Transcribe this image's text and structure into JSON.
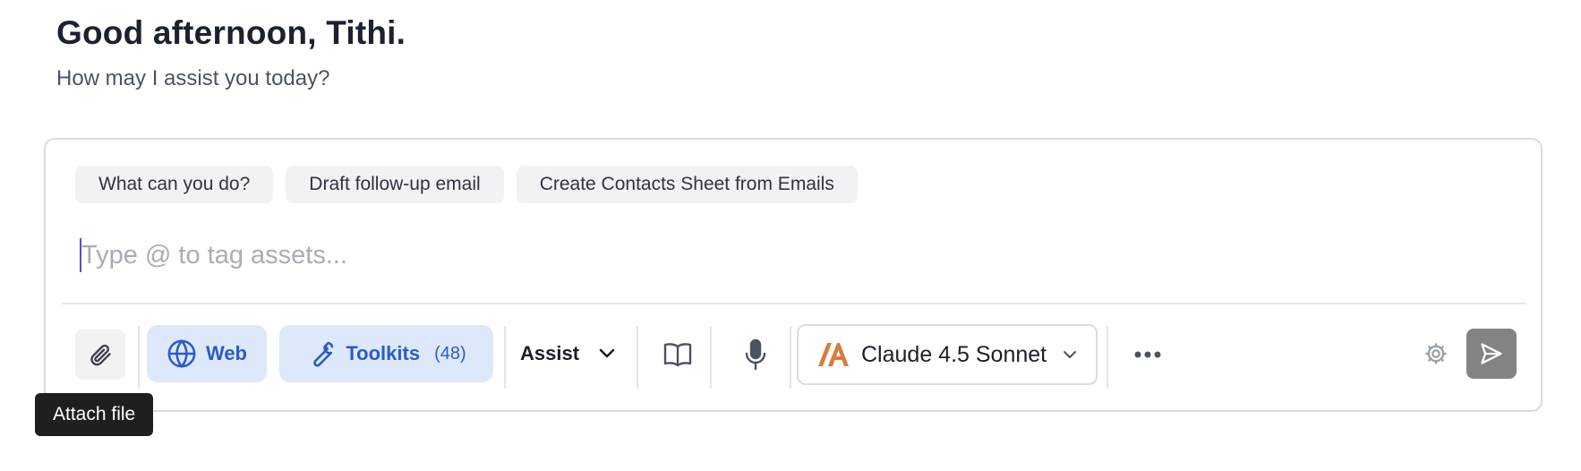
{
  "greeting": "Good afternoon, Tithi.",
  "subtitle": "How may I assist you today?",
  "suggestions": [
    "What can you do?",
    "Draft follow-up email",
    "Create Contacts Sheet from Emails"
  ],
  "input": {
    "placeholder": "Type @ to tag assets...",
    "value": ""
  },
  "toolbar": {
    "web_label": "Web",
    "toolkits_label": "Toolkits",
    "toolkits_count": "(48)",
    "mode_label": "Assist",
    "model_label": "Claude 4.5 Sonnet",
    "icons": [
      "paperclip-icon",
      "globe-icon",
      "wrench-icon",
      "chevron-down-icon",
      "book-icon",
      "microphone-icon",
      "anthropic-logo-icon",
      "more-icon",
      "gear-icon",
      "send-icon"
    ]
  },
  "tooltip": "Attach file",
  "colors": {
    "accent": "#2b5bc8",
    "pill_bg": "#dde8fb",
    "model_logo": "#d97b3a",
    "send_bg": "#828385"
  }
}
